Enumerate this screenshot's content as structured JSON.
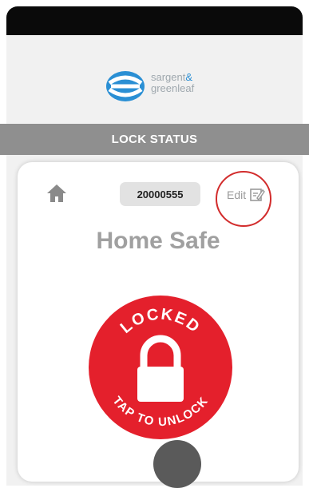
{
  "app": {
    "logo_line1": "sargent",
    "logo_amp": "&",
    "logo_line2": "greenleaf"
  },
  "section": {
    "title": "LOCK STATUS"
  },
  "lock": {
    "serial": "20000555",
    "edit_label": "Edit",
    "name": "Home Safe",
    "status_text": "LOCKED",
    "action_text": "TAP TO UNLOCK"
  },
  "colors": {
    "accent_red": "#e4202c",
    "brand_blue": "#2a8fd4",
    "section_gray": "#8f8f8f"
  },
  "icons": {
    "home": "home-icon",
    "edit": "edit-icon",
    "padlock": "padlock-icon"
  }
}
